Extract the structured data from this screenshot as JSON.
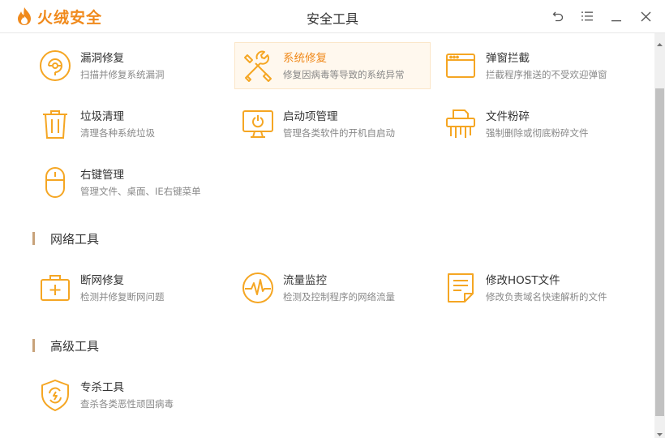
{
  "app": {
    "brand": "火绒安全",
    "window_title": "安全工具"
  },
  "colors": {
    "accent": "#f08a1c",
    "icon": "#f5a623"
  },
  "window_controls": [
    {
      "name": "back-icon"
    },
    {
      "name": "menu-icon"
    },
    {
      "name": "minimize-icon"
    },
    {
      "name": "close-icon"
    }
  ],
  "system_tools": [
    {
      "title": "漏洞修复",
      "desc": "扫描并修复系统漏洞",
      "icon": "shield-repair-icon"
    },
    {
      "title": "系统修复",
      "desc": "修复因病毒等导致的系统异常",
      "icon": "wrench-screwdriver-icon",
      "active": true
    },
    {
      "title": "弹窗拦截",
      "desc": "拦截程序推送的不受欢迎弹窗",
      "icon": "window-icon"
    },
    {
      "title": "垃圾清理",
      "desc": "清理各种系统垃圾",
      "icon": "trash-icon"
    },
    {
      "title": "启动项管理",
      "desc": "管理各类软件的开机自启动",
      "icon": "monitor-icon"
    },
    {
      "title": "文件粉碎",
      "desc": "强制删除或彻底粉碎文件",
      "icon": "shredder-icon"
    },
    {
      "title": "右键管理",
      "desc": "管理文件、桌面、IE右键菜单",
      "icon": "mouse-icon"
    }
  ],
  "network_section": {
    "title": "网络工具"
  },
  "network_tools": [
    {
      "title": "断网修复",
      "desc": "检测并修复断网问题",
      "icon": "medkit-icon"
    },
    {
      "title": "流量监控",
      "desc": "检测及控制程序的网络流量",
      "icon": "pulse-icon"
    },
    {
      "title": "修改HOST文件",
      "desc": "修改负责域名快速解析的文件",
      "icon": "document-icon"
    }
  ],
  "advanced_section": {
    "title": "高级工具"
  },
  "advanced_tools": [
    {
      "title": "专杀工具",
      "desc": "查杀各类恶性顽固病毒",
      "icon": "shield-kill-icon"
    }
  ]
}
